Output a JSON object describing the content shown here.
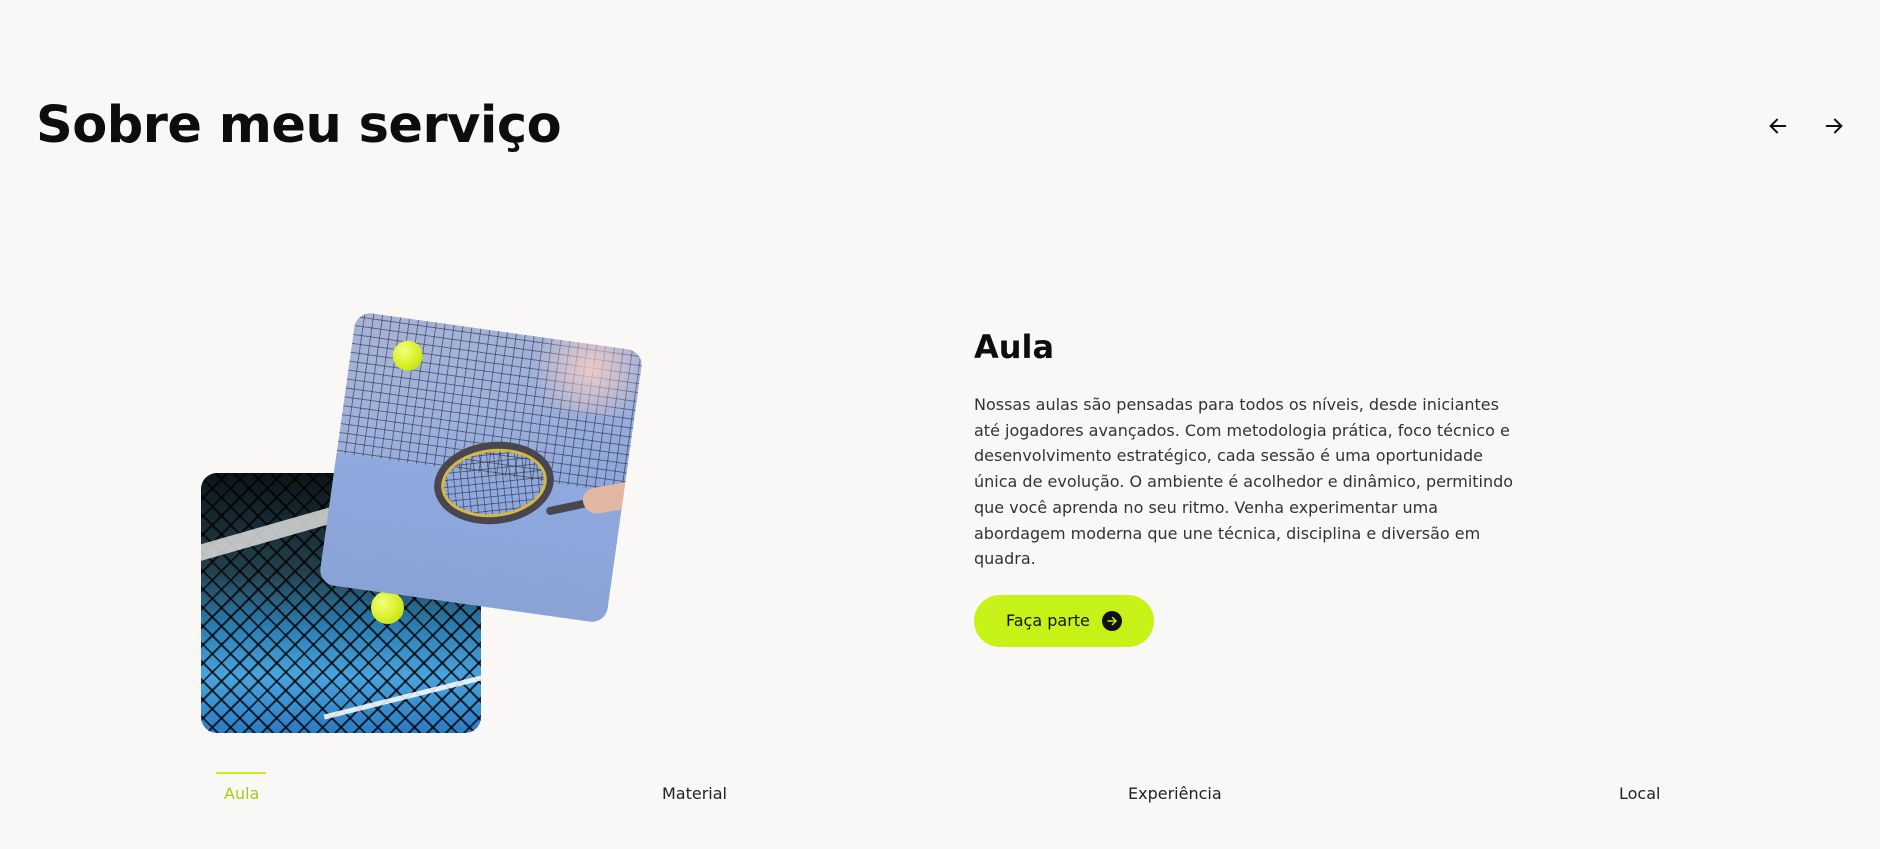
{
  "section": {
    "title": "Sobre meu serviço"
  },
  "nav": {
    "prev_icon": "arrow-left-icon",
    "next_icon": "arrow-right-icon"
  },
  "content": {
    "title": "Aula",
    "body": "Nossas aulas são pensadas para todos os níveis, desde iniciantes até jogadores avançados. Com metodologia prática, foco técnico e desenvolvimento estratégico, cada sessão é uma oportunidade única de evolução. O ambiente é acolhedor e dinâmico, permitindo que você aprenda no seu ritmo. Venha experimentar uma abordagem moderna que une técnica, disciplina e diversão em quadra.",
    "cta_label": "Faça parte",
    "cta_icon": "arrow-right-circle-icon"
  },
  "tabs": [
    {
      "label": "Aula",
      "active": true
    },
    {
      "label": "Material",
      "active": false
    },
    {
      "label": "Experiência",
      "active": false
    },
    {
      "label": "Local",
      "active": false
    }
  ],
  "colors": {
    "background": "#faf8f7",
    "accent": "#c6f217",
    "accent_text": "#a6cc17",
    "text": "#111111"
  }
}
